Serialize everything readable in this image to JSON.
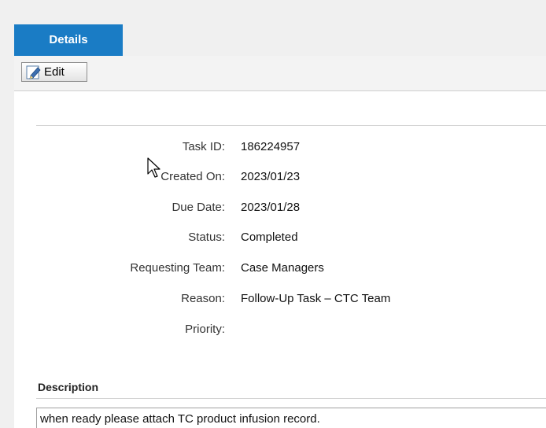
{
  "tabs": [
    {
      "label": "Details",
      "active": true
    }
  ],
  "toolbar": {
    "edit_label": "Edit",
    "edit_icon": "pencil-edit-icon"
  },
  "fields": {
    "task_id": {
      "label": "Task ID:",
      "value": "186224957"
    },
    "created_on": {
      "label": "Created On:",
      "value": "2023/01/23"
    },
    "due_date": {
      "label": "Due Date:",
      "value": "2023/01/28"
    },
    "status": {
      "label": "Status:",
      "value": "Completed"
    },
    "requesting_team": {
      "label": "Requesting Team:",
      "value": "Case Managers"
    },
    "reason": {
      "label": "Reason:",
      "value": "Follow-Up Task – CTC Team"
    },
    "priority": {
      "label": "Priority:",
      "value": ""
    }
  },
  "description": {
    "title": "Description",
    "text": "when ready please attach TC product infusion record."
  },
  "colors": {
    "tab_active": "#1a7cc5",
    "background": "#f0f0f0",
    "content": "#ffffff"
  }
}
